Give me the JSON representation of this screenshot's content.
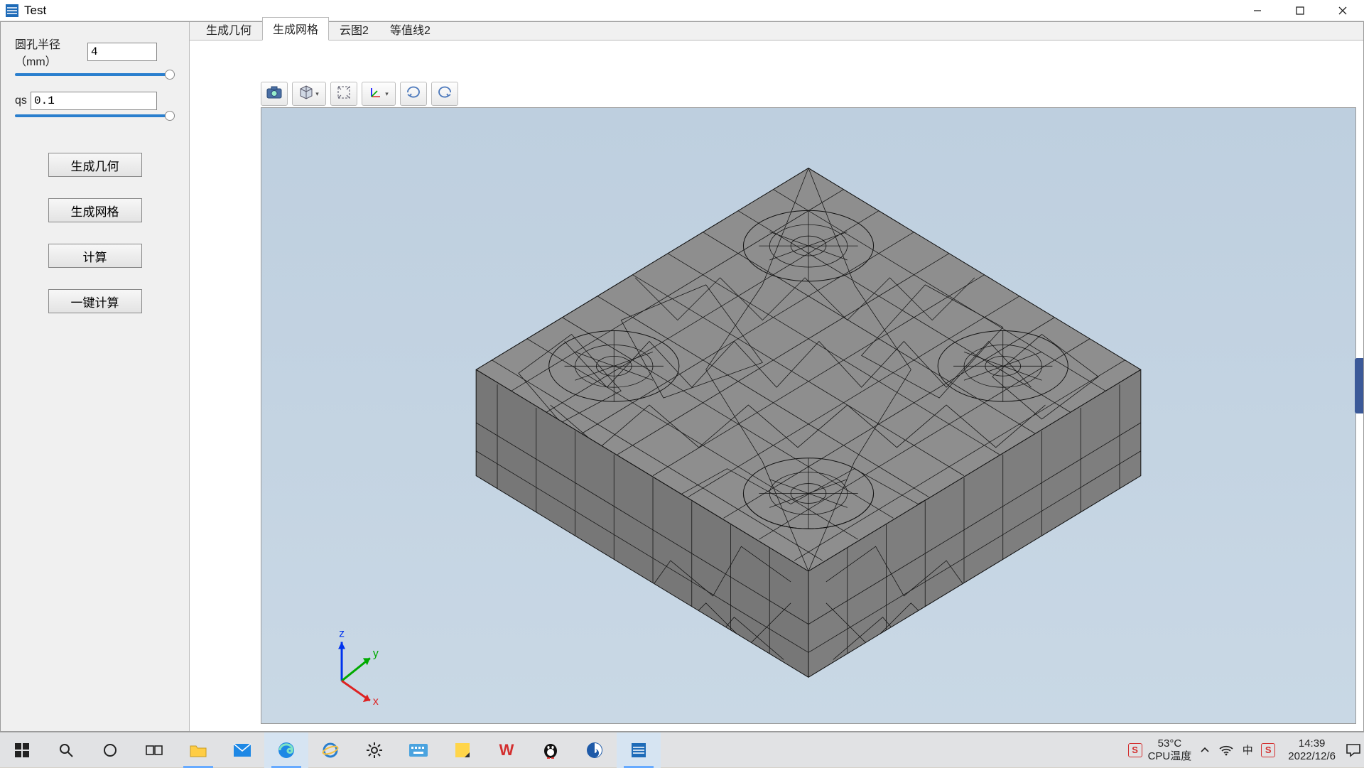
{
  "window": {
    "title": "Test"
  },
  "sidebar": {
    "param1": {
      "label": "圆孔半径（mm）",
      "value": "4"
    },
    "param2": {
      "label": "qs",
      "value": "0.1"
    },
    "buttons": {
      "gen_geometry": "生成几何",
      "gen_mesh": "生成网格",
      "compute": "计算",
      "one_click": "一键计算"
    }
  },
  "tabs": [
    {
      "label": "生成几何",
      "active": false
    },
    {
      "label": "生成网格",
      "active": true
    },
    {
      "label": "云图2",
      "active": false
    },
    {
      "label": "等值线2",
      "active": false
    }
  ],
  "viewport_toolbar": {
    "camera": "camera-icon",
    "cube": "cube-view-icon",
    "fit": "fit-view-icon",
    "axes": "axes-icon",
    "orbit": "orbit-icon",
    "rotate": "rotate-icon"
  },
  "axis_labels": {
    "x": "x",
    "y": "y",
    "z": "z"
  },
  "systray": {
    "temp": "53°C",
    "temp_label": "CPU温度",
    "time": "14:39",
    "date": "2022/12/6"
  }
}
